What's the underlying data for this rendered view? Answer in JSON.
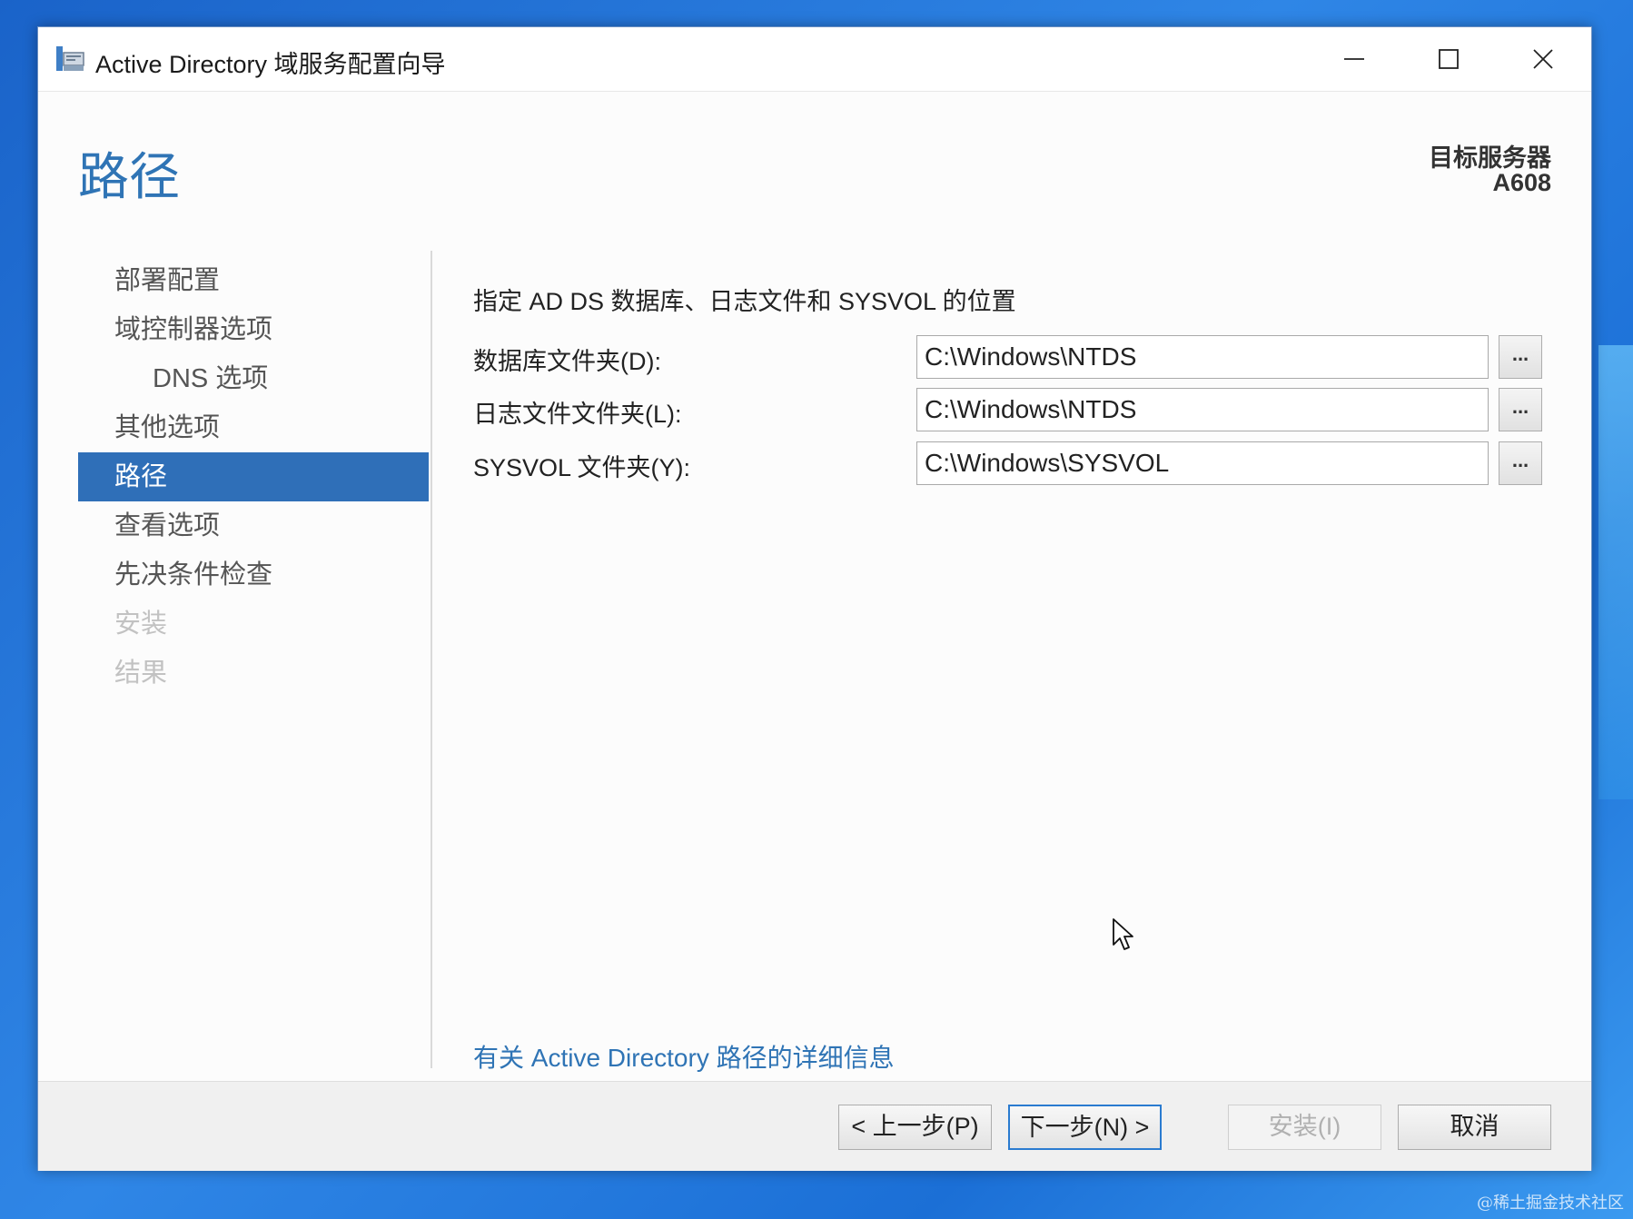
{
  "window": {
    "title": "Active Directory 域服务配置向导",
    "controls": [
      "minimize",
      "maximize",
      "close"
    ]
  },
  "header": {
    "page_title": "路径",
    "target_server_label": "目标服务器",
    "target_server_value": "A608"
  },
  "nav": {
    "items": [
      {
        "label": "部署配置",
        "state": "normal"
      },
      {
        "label": "域控制器选项",
        "state": "normal"
      },
      {
        "label": "DNS 选项",
        "state": "normal",
        "indent": true
      },
      {
        "label": "其他选项",
        "state": "normal"
      },
      {
        "label": "路径",
        "state": "active"
      },
      {
        "label": "查看选项",
        "state": "normal"
      },
      {
        "label": "先决条件检查",
        "state": "normal"
      },
      {
        "label": "安装",
        "state": "disabled"
      },
      {
        "label": "结果",
        "state": "disabled"
      }
    ]
  },
  "content": {
    "description": "指定 AD DS 数据库、日志文件和 SYSVOL 的位置",
    "fields": [
      {
        "label": "数据库文件夹(D):",
        "value": "C:\\Windows\\NTDS",
        "browse": "..."
      },
      {
        "label": "日志文件文件夹(L):",
        "value": "C:\\Windows\\NTDS",
        "browse": "..."
      },
      {
        "label": "SYSVOL 文件夹(Y):",
        "value": "C:\\Windows\\SYSVOL",
        "browse": "..."
      }
    ],
    "more_info_link": "有关 Active Directory 路径的详细信息"
  },
  "footer": {
    "prev": "< 上一步(P)",
    "next": "下一步(N) >",
    "install": "安装(I)",
    "cancel": "取消"
  },
  "watermark": "@稀土掘金技术社区",
  "colors": {
    "accent": "#2f6fb8",
    "title_blue": "#2f74b5",
    "desktop": "#2f86e6"
  }
}
